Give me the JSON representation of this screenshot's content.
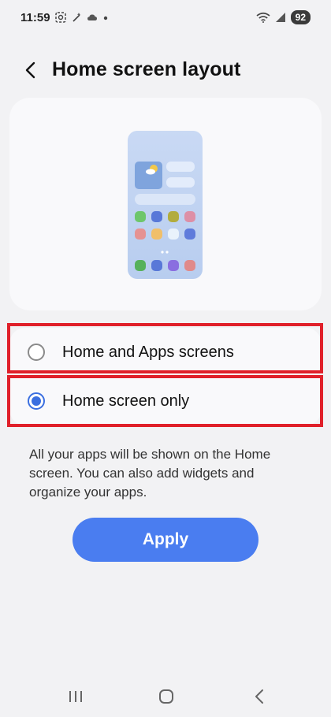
{
  "status_bar": {
    "time": "11:59",
    "battery": "92",
    "icons": [
      "screenshot-icon",
      "magic-wand-icon",
      "cloud-icon",
      "dot-icon",
      "wifi-icon",
      "signal-icon",
      "battery-icon"
    ]
  },
  "header": {
    "title": "Home screen layout",
    "back_icon": "chevron-left-icon"
  },
  "options": [
    {
      "label": "Home and Apps screens",
      "selected": false
    },
    {
      "label": "Home screen only",
      "selected": true
    }
  ],
  "description": "All your apps will be shown on the Home screen. You can also add widgets and organize your apps.",
  "apply_label": "Apply",
  "colors": {
    "accent": "#4a7df0",
    "radio_selected": "#3b6fe0",
    "highlight": "#e0202a",
    "background": "#f2f2f4"
  },
  "nav_bar": {
    "icons": [
      "recents-icon",
      "home-icon",
      "back-icon"
    ]
  }
}
